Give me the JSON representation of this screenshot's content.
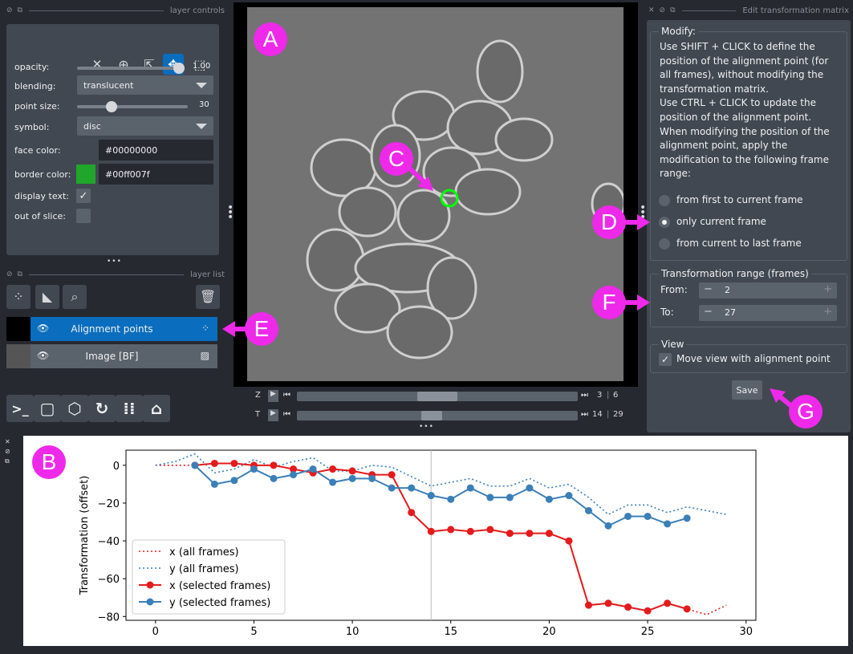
{
  "layer_controls": {
    "header": "layer controls",
    "opacity_label": "opacity:",
    "opacity_value": "1.00",
    "opacity_fraction": 1.0,
    "blending_label": "blending:",
    "blending_value": "translucent",
    "point_size_label": "point size:",
    "point_size_value": "30",
    "symbol_label": "symbol:",
    "symbol_value": "disc",
    "face_color_label": "face color:",
    "face_color_value": "#00000000",
    "border_color_label": "border color:",
    "border_color_value": "#00ff007f",
    "border_color_swatch": "#1fa62b",
    "display_text_label": "display text:",
    "display_text_checked": "✓",
    "out_of_slice_label": "out of slice:",
    "tools": [
      "close-icon",
      "add-point-icon",
      "select-icon",
      "pan-zoom-icon",
      "transform-icon"
    ]
  },
  "layer_list": {
    "header": "layer list",
    "layers": [
      {
        "name": "Alignment points",
        "selected": true
      },
      {
        "name": "Image [BF]",
        "selected": false
      }
    ]
  },
  "canvas": {
    "dims": {
      "z_label": "Z",
      "z_value": "3",
      "z_total": "6",
      "t_label": "T",
      "t_value": "14",
      "t_total": "29"
    }
  },
  "edit_panel": {
    "header": "Edit transformation matrix",
    "modify_title": "Modify:",
    "modify_lines": [
      "Use SHIFT + CLICK to define the",
      "position of the alignment point (for",
      "all frames), without modifying the",
      "transformation matrix.",
      "Use CTRL + CLICK to update the",
      "position of the alignment point.",
      "When modifying the position of the",
      "alignment point, apply the",
      "modification to the following frame",
      "range:"
    ],
    "radio_options": [
      "from first to current frame",
      "only current frame",
      "from current to last frame"
    ],
    "range_title": "Transformation range (frames)",
    "from_label": "From:",
    "from_value": "2",
    "to_label": "To:",
    "to_value": "27",
    "view_title": "View",
    "move_view_label": "Move view with alignment point",
    "save_label": "Save"
  },
  "badges": {
    "a": "A",
    "b": "B",
    "c": "C",
    "d": "D",
    "e": "E",
    "f": "F",
    "g": "G"
  },
  "colors": {
    "accent": "#0a6dbe",
    "badge": "#ee29e9",
    "x_series": "#e41a1c",
    "y_series": "#3b7fb8",
    "point": "#00ff00"
  },
  "chart_data": {
    "type": "line",
    "ylabel": "Transformation (offset)",
    "xlim": [
      -1.5,
      30.5
    ],
    "ylim": [
      -82,
      8
    ],
    "x_ticks": [
      0,
      5,
      10,
      15,
      20,
      25,
      30
    ],
    "y_ticks": [
      0,
      -20,
      -40,
      -60,
      -80
    ],
    "vline_x": 14,
    "legend_position": "bottom-left",
    "series": [
      {
        "name": "x (all frames)",
        "style": "dotted",
        "color": "#e41a1c",
        "x": [
          0,
          1,
          2,
          3,
          4,
          5,
          6,
          7,
          8,
          9,
          10,
          11,
          12,
          13,
          14,
          15,
          16,
          17,
          18,
          19,
          20,
          21,
          22,
          23,
          24,
          25,
          26,
          27,
          28,
          29
        ],
        "y": [
          0,
          0,
          0,
          1,
          1,
          0,
          0,
          -2,
          -4,
          -2,
          -3,
          -5,
          -5,
          -25,
          -35,
          -34,
          -35,
          -34,
          -36,
          -36,
          -36,
          -40,
          -74,
          -73,
          -75,
          -77,
          -73,
          -76,
          -79,
          -74
        ]
      },
      {
        "name": "y (all frames)",
        "style": "dotted",
        "color": "#3b7fb8",
        "x": [
          0,
          1,
          2,
          3,
          4,
          5,
          6,
          7,
          8,
          9,
          10,
          11,
          12,
          13,
          14,
          15,
          16,
          17,
          18,
          19,
          20,
          21,
          22,
          23,
          24,
          25,
          26,
          27,
          28,
          29
        ],
        "y": [
          0,
          2,
          6,
          -4,
          -2,
          3,
          -1,
          2,
          4,
          -3,
          -3,
          0,
          -1,
          -6,
          -11,
          -9,
          -7,
          -11,
          -11,
          -7,
          -12,
          -10,
          -17,
          -26,
          -21,
          -21,
          -25,
          -22,
          -24,
          -26
        ]
      },
      {
        "name": "x (selected frames)",
        "style": "solid-marker",
        "color": "#e41a1c",
        "x": [
          2,
          3,
          4,
          5,
          6,
          7,
          8,
          9,
          10,
          11,
          12,
          13,
          14,
          15,
          16,
          17,
          18,
          19,
          20,
          21,
          22,
          23,
          24,
          25,
          26,
          27
        ],
        "y": [
          0,
          1,
          1,
          0,
          0,
          -2,
          -4,
          -2,
          -3,
          -5,
          -5,
          -25,
          -35,
          -34,
          -35,
          -34,
          -36,
          -36,
          -36,
          -40,
          -74,
          -73,
          -75,
          -77,
          -73,
          -76
        ]
      },
      {
        "name": "y (selected frames)",
        "style": "solid-marker",
        "color": "#3b7fb8",
        "x": [
          2,
          3,
          4,
          5,
          6,
          7,
          8,
          9,
          10,
          11,
          12,
          13,
          14,
          15,
          16,
          17,
          18,
          19,
          20,
          21,
          22,
          23,
          24,
          25,
          26,
          27
        ],
        "y": [
          0,
          -10,
          -8,
          -2,
          -7,
          -5,
          -2,
          -9,
          -7,
          -7,
          -12,
          -12,
          -16,
          -18,
          -12,
          -17,
          -17,
          -12,
          -18,
          -16,
          -24,
          -32,
          -27,
          -27,
          -31,
          -28
        ]
      }
    ]
  }
}
